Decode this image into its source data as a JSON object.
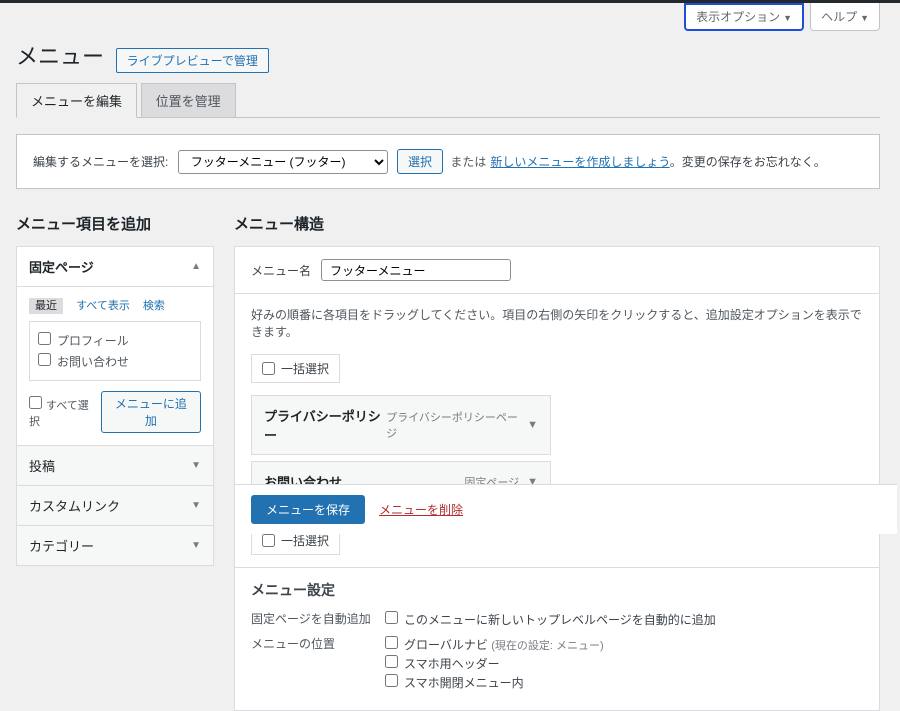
{
  "screenMeta": {
    "screenOptions": "表示オプション",
    "help": "ヘルプ"
  },
  "page": {
    "title": "メニュー",
    "livePreview": "ライブプレビューで管理"
  },
  "tabs": {
    "edit": "メニューを編集",
    "locations": "位置を管理"
  },
  "manage": {
    "label": "編集するメニューを選択:",
    "selected": "フッターメニュー (フッター)",
    "selectBtn": "選択",
    "or": "または",
    "createNew": "新しいメニューを作成しましょう",
    "reminder": "。変更の保存をお忘れなく。"
  },
  "addItems": {
    "heading": "メニュー項目を追加",
    "sections": {
      "pages": "固定ページ",
      "posts": "投稿",
      "customLinks": "カスタムリンク",
      "categories": "カテゴリー"
    },
    "pageTabs": {
      "recent": "最近",
      "all": "すべて表示",
      "search": "検索"
    },
    "pageItems": [
      "プロフィール",
      "お問い合わせ"
    ],
    "selectAll": "すべて選択",
    "addToMenu": "メニューに追加"
  },
  "structure": {
    "heading": "メニュー構造",
    "nameLabel": "メニュー名",
    "nameValue": "フッターメニュー",
    "instructions": "好みの順番に各項目をドラッグしてください。項目の右側の矢印をクリックすると、追加設定オプションを表示できます。",
    "bulkSelect": "一括選択",
    "items": [
      {
        "title": "プライバシーポリシー",
        "type": "プライバシーポリシーページ"
      },
      {
        "title": "お問い合わせ",
        "type": "固定ページ"
      }
    ]
  },
  "settings": {
    "heading": "メニュー設定",
    "autoAdd": {
      "label": "固定ページを自動追加",
      "option": "このメニューに新しいトップレベルページを自動的に追加"
    },
    "location": {
      "label": "メニューの位置",
      "options": [
        "グローバルナビ",
        "スマホ用ヘッダー",
        "スマホ開閉メニュー内"
      ],
      "hint": "(現在の設定: メニュー)"
    }
  },
  "footer": {
    "save": "メニューを保存",
    "delete": "メニューを削除"
  }
}
